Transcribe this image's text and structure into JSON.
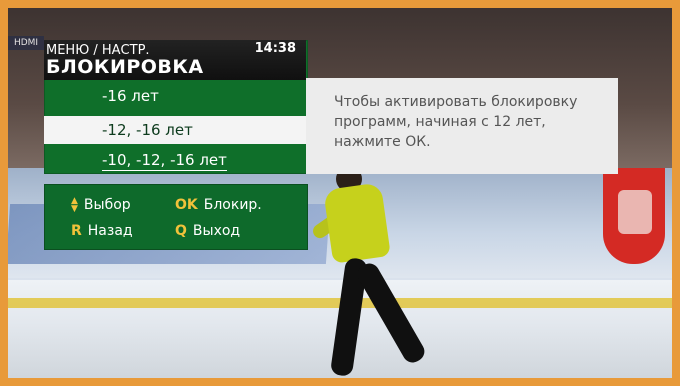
{
  "osd": {
    "breadcrumb": "МЕНЮ / НАСТР.",
    "time": "14:38",
    "title": "БЛОКИРОВКА",
    "options": [
      {
        "label": "-16 лет",
        "selected": false
      },
      {
        "label": "-12, -16 лет",
        "selected": true
      },
      {
        "label": "-10, -12, -16 лет",
        "selected": false
      }
    ],
    "help_text": "Чтобы активировать блокировку программ, начиная с 12 лет, нажмите ОК.",
    "keys": {
      "select_label": "Выбор",
      "ok_key": "OK",
      "ok_label": "Блокир.",
      "back_key": "R",
      "back_label": "Назад",
      "quit_key": "Q",
      "quit_label": "Выход"
    },
    "channel_badge": "HDMI"
  },
  "colors": {
    "osd_green": "#0f6f2a",
    "highlight_white": "#f4f4f4",
    "key_gold": "#f0c23a",
    "frame_orange": "#e89a3a"
  },
  "icons": {
    "select": "up-down-arrows-icon"
  }
}
